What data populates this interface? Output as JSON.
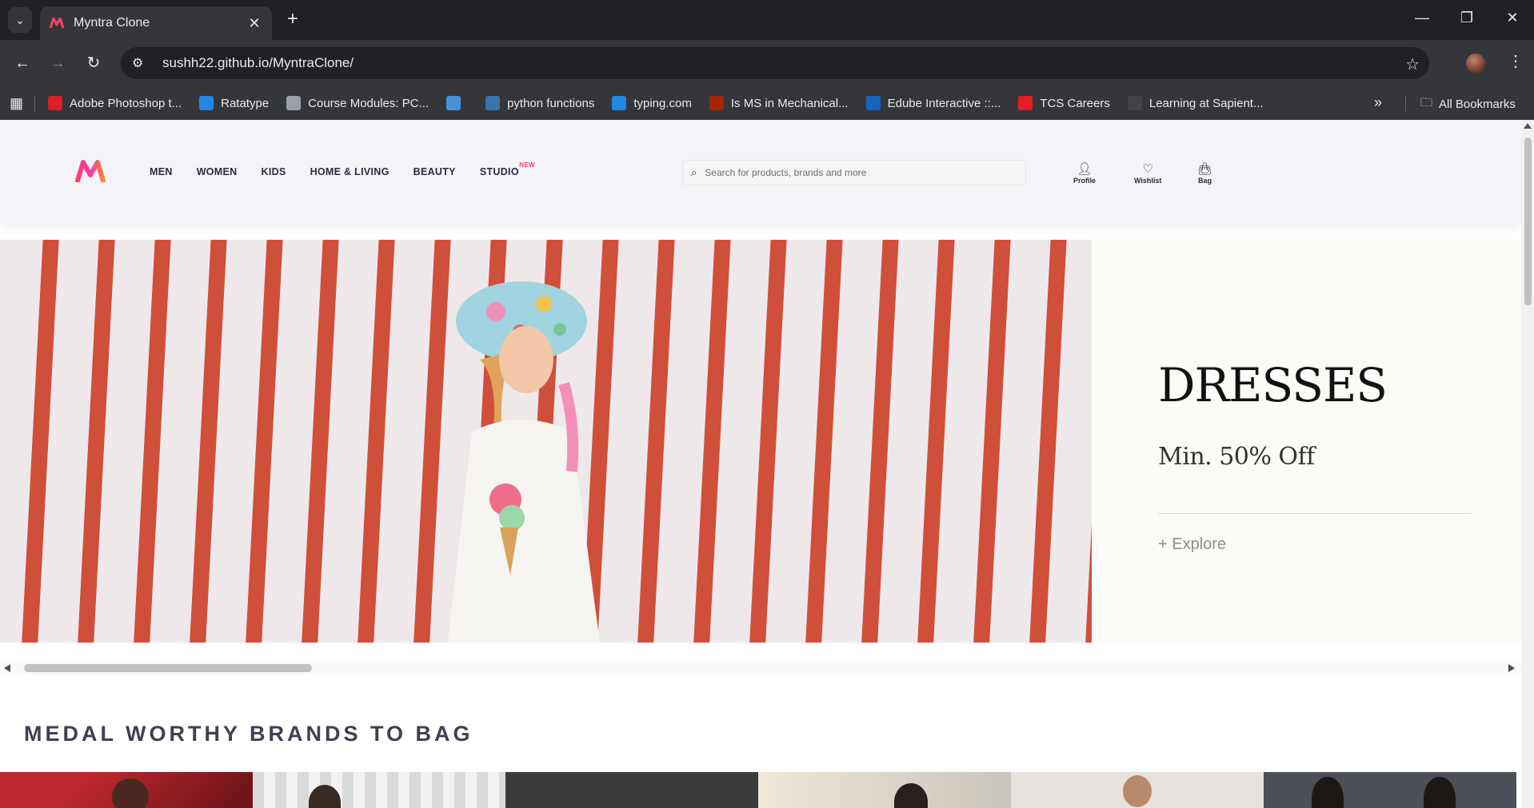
{
  "browser": {
    "tab_title": "Myntra Clone",
    "url": "sushh22.github.io/MyntraClone/",
    "bookmarks": [
      {
        "label": "Adobe Photoshop t...",
        "icon": "adobe-icon",
        "color": "#da1f26"
      },
      {
        "label": "Ratatype",
        "icon": "ratatype-icon",
        "color": "#1e88e5"
      },
      {
        "label": "Course Modules: PC...",
        "icon": "globe-icon",
        "color": "#9aa0a6"
      },
      {
        "label": "",
        "icon": "link-icon",
        "color": "#4a90d9"
      },
      {
        "label": "python functions",
        "icon": "python-icon",
        "color": "#3776ab"
      },
      {
        "label": "typing.com",
        "icon": "typing-icon",
        "color": "#1e88e5"
      },
      {
        "label": "Is MS in Mechanical...",
        "icon": "quora-icon",
        "color": "#a82400"
      },
      {
        "label": "Edube Interactive ::...",
        "icon": "edube-icon",
        "color": "#1565c0"
      },
      {
        "label": "TCS Careers",
        "icon": "tcs-icon",
        "color": "#e31e24"
      },
      {
        "label": "Learning at Sapient...",
        "icon": "sapient-icon",
        "color": "#444"
      }
    ],
    "all_bookmarks": "All Bookmarks"
  },
  "header": {
    "nav": [
      "MEN",
      "WOMEN",
      "KIDS",
      "HOME & LIVING",
      "BEAUTY",
      "STUDIO"
    ],
    "studio_badge": "NEW",
    "search_placeholder": "Search for products, brands and more",
    "actions": {
      "profile": "Profile",
      "wishlist": "Wishlist",
      "bag": "Bag"
    },
    "brand_color": "#ff3f6c"
  },
  "banner": {
    "title": "DRESSES",
    "subtitle": "Min. 50% Off",
    "cta": "+ Explore"
  },
  "section": {
    "title": "MEDAL WORTHY BRANDS TO BAG"
  }
}
